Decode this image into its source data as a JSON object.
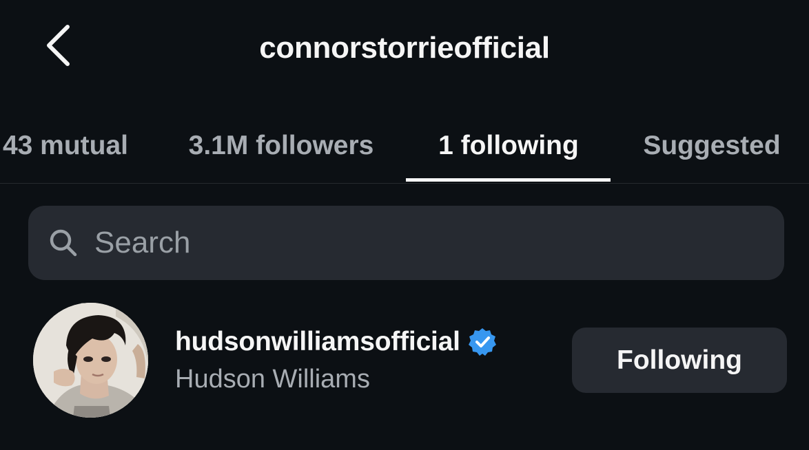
{
  "header": {
    "title": "connorstorrieofficial",
    "back_icon": "chevron-left-icon"
  },
  "tabs": [
    {
      "label": "43 mutual",
      "active": false
    },
    {
      "label": "3.1M followers",
      "active": false
    },
    {
      "label": "1 following",
      "active": true
    },
    {
      "label": "Suggested",
      "active": false
    }
  ],
  "search": {
    "placeholder": "Search",
    "icon": "search-icon"
  },
  "users": [
    {
      "username": "hudsonwilliamsofficial",
      "full_name": "Hudson Williams",
      "verified": true,
      "button_label": "Following"
    }
  ],
  "colors": {
    "background": "#0c1014",
    "text_primary": "#f5f5f5",
    "text_secondary": "#a8adb3",
    "surface": "#262a31",
    "verified_badge": "#3797f0"
  }
}
